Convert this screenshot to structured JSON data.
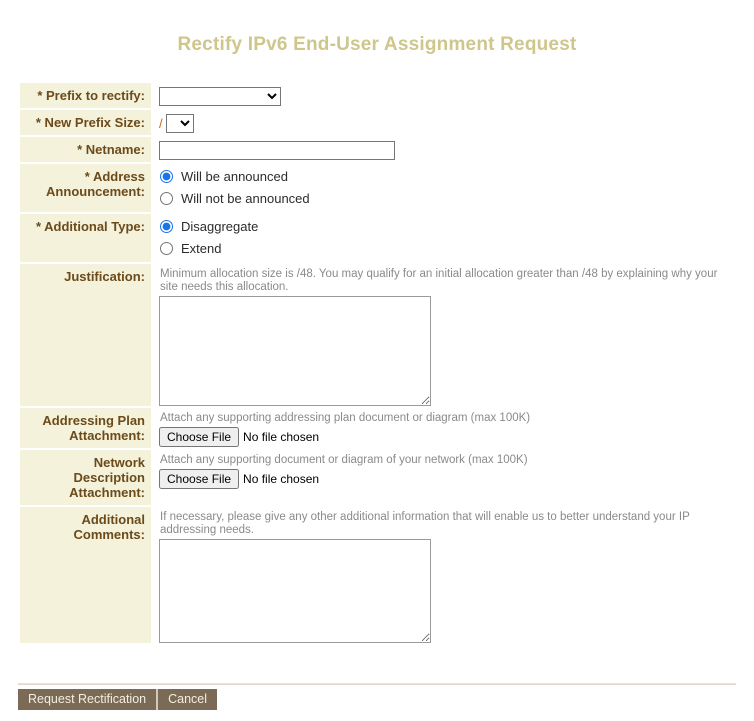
{
  "page": {
    "title": "Rectify IPv6 End-User Assignment Request"
  },
  "form": {
    "rows": [
      {
        "label": "* Prefix to rectify:",
        "type": "select",
        "value": "",
        "options": [
          ""
        ]
      },
      {
        "label": "* New Prefix Size:",
        "type": "prefix-size",
        "slash": "/",
        "value": "",
        "options": [
          ""
        ]
      },
      {
        "label": "* Netname:",
        "type": "text",
        "value": "",
        "placeholder": ""
      },
      {
        "label": "* Address Announcement:",
        "type": "radio",
        "selected": "Will be announced",
        "options": [
          "Will be announced",
          "Will not be announced"
        ]
      },
      {
        "label": "* Additional Type:",
        "type": "radio",
        "selected": "Disaggregate",
        "options": [
          "Disaggregate",
          "Extend"
        ]
      },
      {
        "label": "Justification:",
        "type": "textarea",
        "help": "Minimum allocation size is /48. You may qualify for an initial allocation greater than /48 by explaining why your site needs this allocation.",
        "value": ""
      },
      {
        "label": "Addressing Plan Attachment:",
        "type": "file",
        "help": "Attach any supporting addressing plan document or diagram (max 100K)",
        "button_label": "Choose file",
        "status": "No file chosen"
      },
      {
        "label": "Network Description Attachment:",
        "type": "file",
        "help": "Attach any supporting document or diagram of your network (max 100K)",
        "button_label": "Choose file",
        "status": "No file chosen"
      },
      {
        "label": "Additional Comments:",
        "type": "textarea",
        "help": "If necessary, please give any other additional information that will enable us to better understand your IP addressing needs.",
        "value": ""
      }
    ]
  },
  "buttons": {
    "submit_label": "Request Rectification",
    "cancel_label": "Cancel"
  },
  "colors": {
    "title": "#cfc68b",
    "label_bg": "#f4f2da",
    "label_text": "#6b4a1b",
    "button_bg": "#7b6a55",
    "button_text": "#f3efe2",
    "help_text": "#8a8a8a",
    "slash": "#c06820",
    "radio_accent": "#1a73e8"
  }
}
